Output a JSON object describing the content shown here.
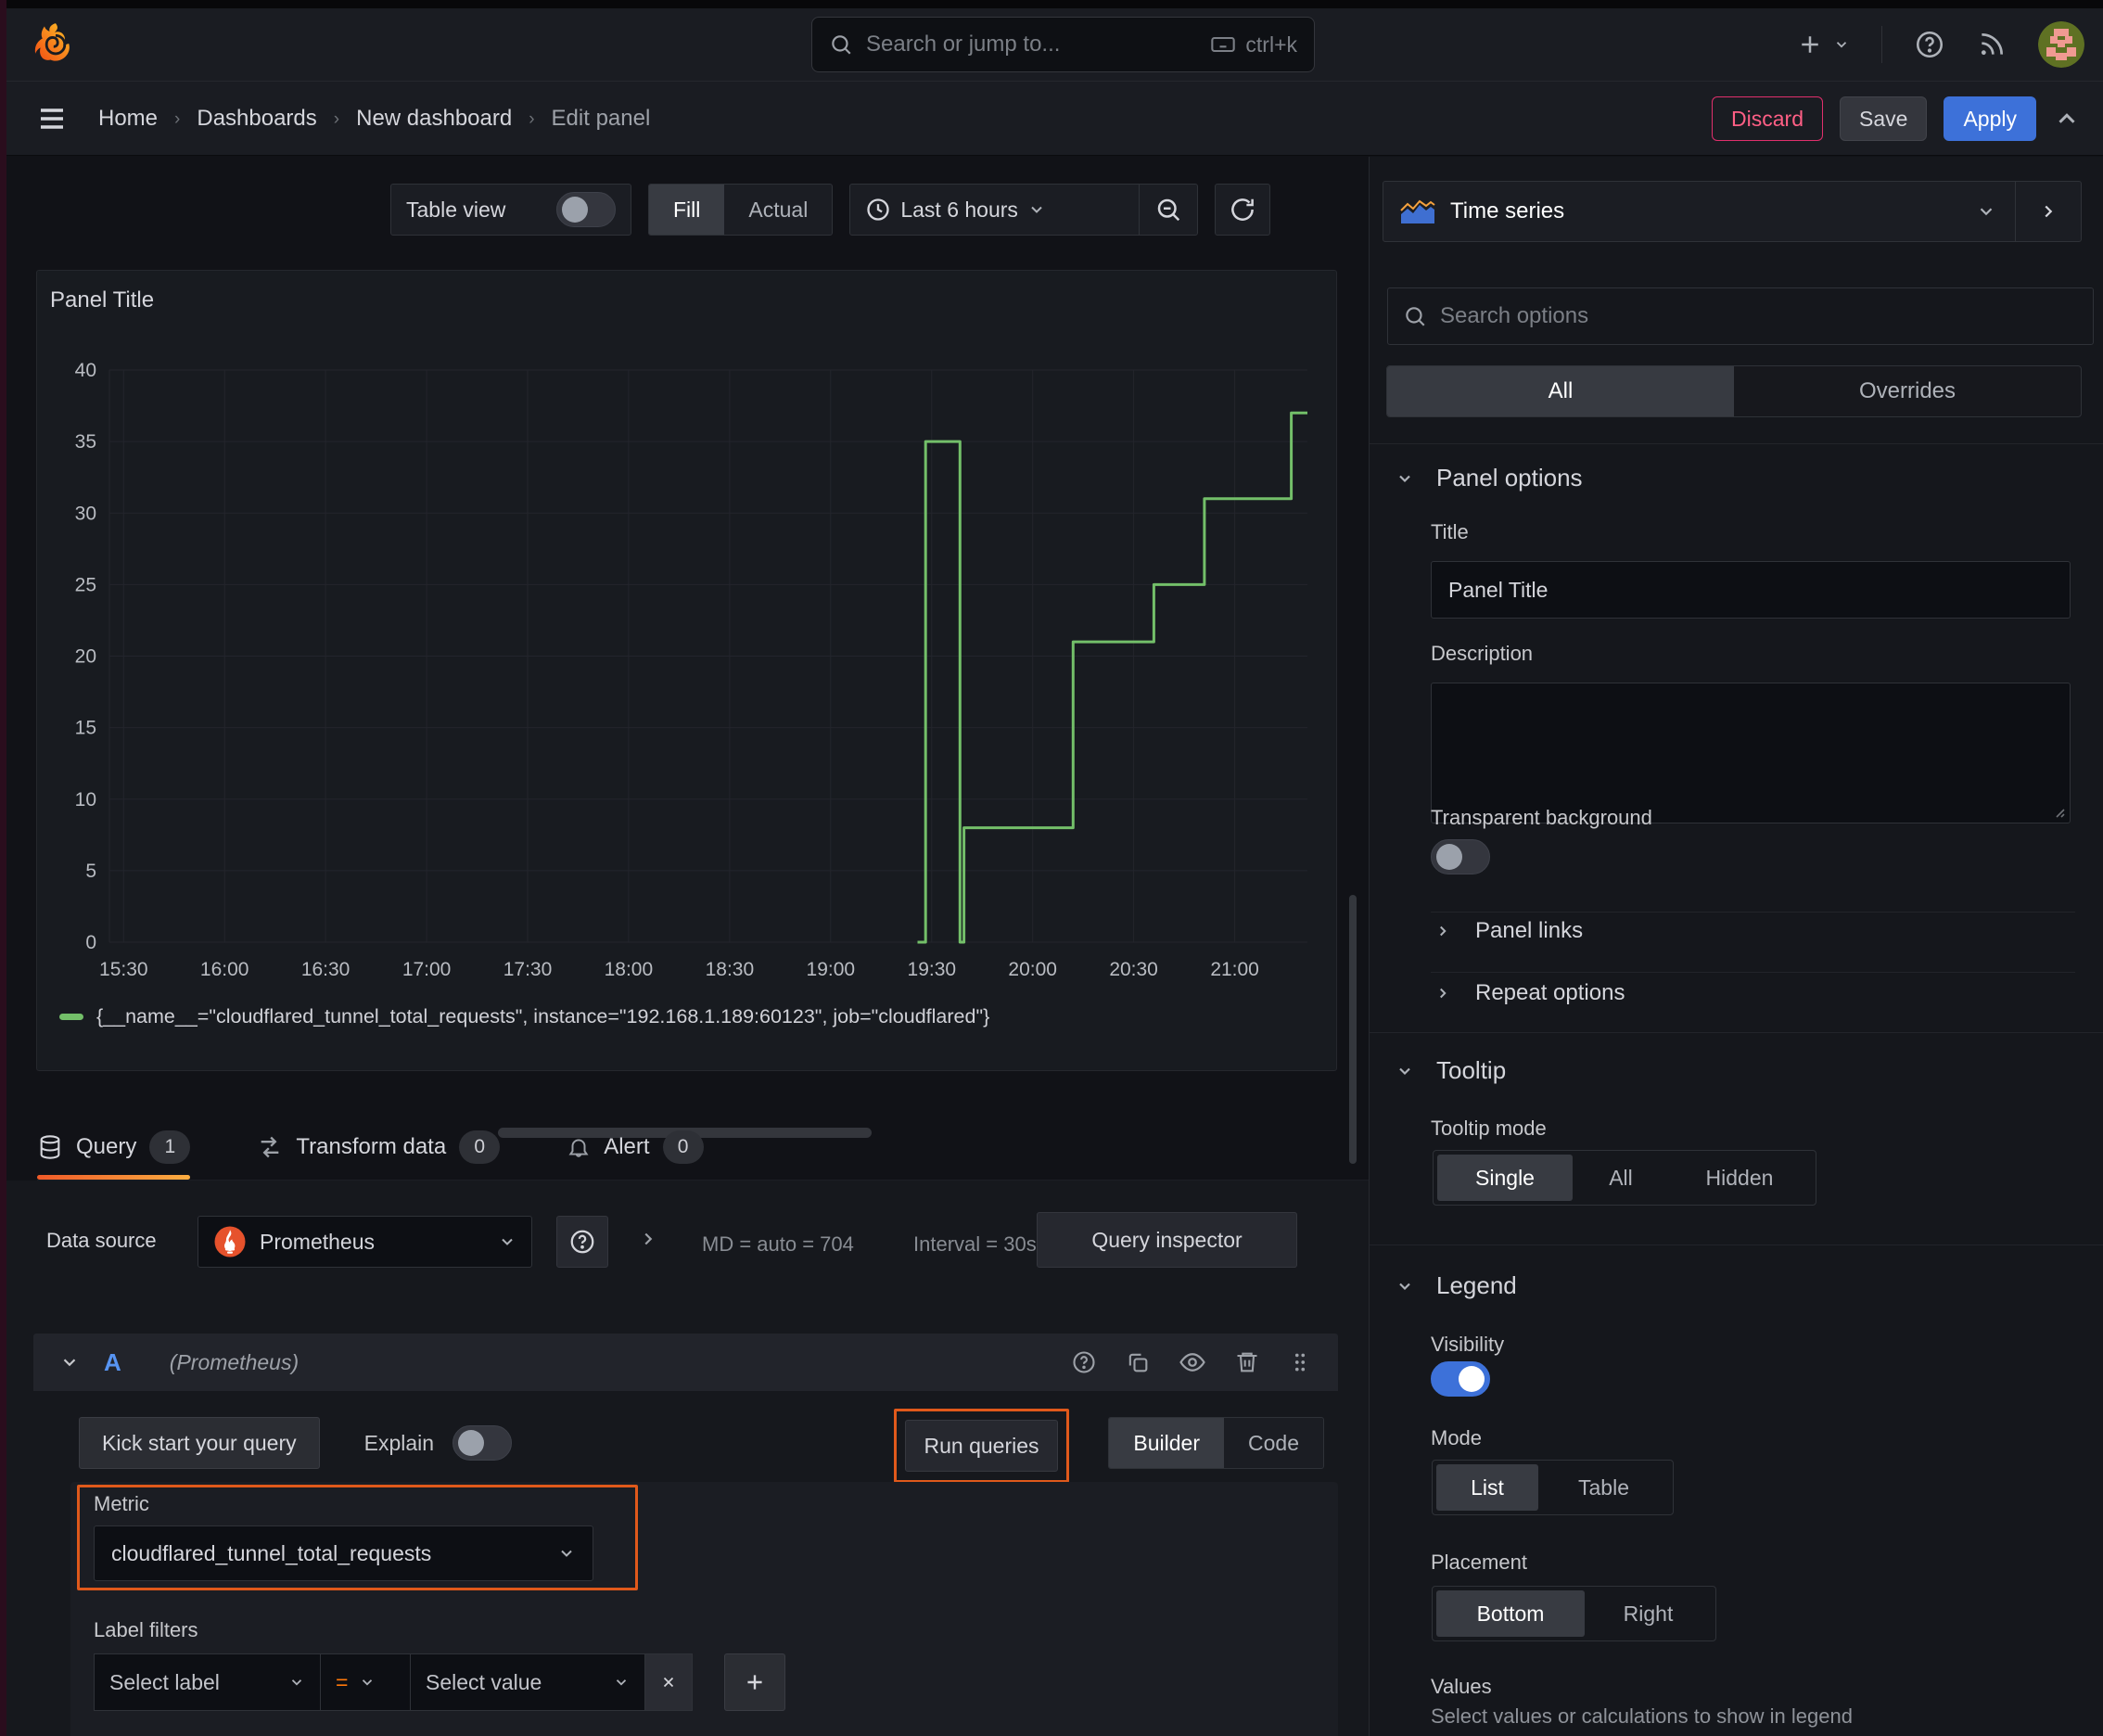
{
  "colors": {
    "accent_orange": "#e0591b",
    "series_green": "#73BF69",
    "apply_blue": "#3d71d9",
    "discard_pink": "#e02f6c"
  },
  "topbar": {
    "search_placeholder": "Search or jump to...",
    "shortcut": "ctrl+k"
  },
  "breadcrumb": {
    "items": [
      "Home",
      "Dashboards",
      "New dashboard",
      "Edit panel"
    ]
  },
  "actions": {
    "discard": "Discard",
    "save": "Save",
    "apply": "Apply"
  },
  "viz_toolbar": {
    "table_view": "Table view",
    "fill": "Fill",
    "actual": "Actual",
    "time_range": "Last 6 hours"
  },
  "panel": {
    "title": "Panel Title"
  },
  "chart_data": {
    "type": "line",
    "step": true,
    "title": "Panel Title",
    "xlim": [
      15.43,
      21.36
    ],
    "ylim": [
      0,
      40
    ],
    "yticks": [
      0,
      5,
      10,
      15,
      20,
      25,
      30,
      35,
      40
    ],
    "xticks": [
      {
        "v": 15.5,
        "label": "15:30"
      },
      {
        "v": 16.0,
        "label": "16:00"
      },
      {
        "v": 16.5,
        "label": "16:30"
      },
      {
        "v": 17.0,
        "label": "17:00"
      },
      {
        "v": 17.5,
        "label": "17:30"
      },
      {
        "v": 18.0,
        "label": "18:00"
      },
      {
        "v": 18.5,
        "label": "18:30"
      },
      {
        "v": 19.0,
        "label": "19:00"
      },
      {
        "v": 19.5,
        "label": "19:30"
      },
      {
        "v": 20.0,
        "label": "20:00"
      },
      {
        "v": 20.5,
        "label": "20:30"
      },
      {
        "v": 21.0,
        "label": "21:00"
      }
    ],
    "grid": true,
    "legend_position": "bottom",
    "series": [
      {
        "name": "{__name__=\"cloudflared_tunnel_total_requests\", instance=\"192.168.1.189:60123\", job=\"cloudflared\"}",
        "color": "#73BF69",
        "points": [
          [
            19.43,
            0
          ],
          [
            19.47,
            0
          ],
          [
            19.47,
            35
          ],
          [
            19.64,
            35
          ],
          [
            19.64,
            0
          ],
          [
            19.66,
            0
          ],
          [
            19.66,
            8
          ],
          [
            20.2,
            8
          ],
          [
            20.2,
            21
          ],
          [
            20.6,
            21
          ],
          [
            20.6,
            25
          ],
          [
            20.85,
            25
          ],
          [
            20.85,
            31
          ],
          [
            21.28,
            31
          ],
          [
            21.28,
            37
          ],
          [
            21.36,
            37
          ]
        ]
      }
    ]
  },
  "tabs": {
    "query": "Query",
    "query_count": "1",
    "transform": "Transform data",
    "transform_count": "0",
    "alert": "Alert",
    "alert_count": "0"
  },
  "query": {
    "datasource_label": "Data source",
    "datasource": "Prometheus",
    "stats_md": "MD = auto = 704",
    "stats_interval": "Interval = 30s",
    "inspector": "Query inspector",
    "ref_id": "A",
    "ds_hint": "(Prometheus)",
    "kickstart": "Kick start your query",
    "explain": "Explain",
    "run": "Run queries",
    "builder": "Builder",
    "code": "Code",
    "metric_label": "Metric",
    "metric_value": "cloudflared_tunnel_total_requests",
    "label_filters": "Label filters",
    "select_label": "Select label",
    "operator": "=",
    "select_value": "Select value"
  },
  "sidebar": {
    "viz_type": "Time series",
    "search_placeholder": "Search options",
    "tabs": {
      "all": "All",
      "overrides": "Overrides"
    },
    "panel_options": {
      "title": "Panel options",
      "title_label": "Title",
      "title_value": "Panel Title",
      "description_label": "Description",
      "transparent_label": "Transparent background"
    },
    "panel_links": "Panel links",
    "repeat_options": "Repeat options",
    "tooltip": {
      "title": "Tooltip",
      "mode_label": "Tooltip mode",
      "single": "Single",
      "all": "All",
      "hidden": "Hidden"
    },
    "legend": {
      "title": "Legend",
      "visibility_label": "Visibility",
      "mode_label": "Mode",
      "list": "List",
      "table": "Table",
      "placement_label": "Placement",
      "bottom": "Bottom",
      "right": "Right",
      "values_label": "Values",
      "values_hint": "Select values or calculations to show in legend"
    }
  }
}
